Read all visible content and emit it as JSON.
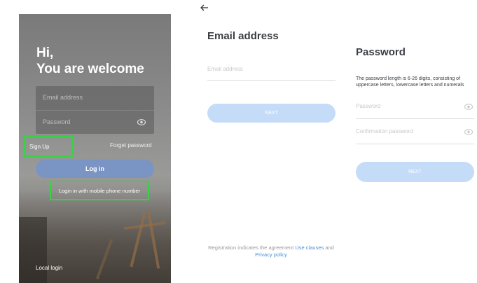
{
  "login": {
    "greeting_line1": "Hi,",
    "greeting_line2": "You are welcome",
    "email_placeholder": "Email address",
    "password_placeholder": "Password",
    "sign_up": "Sign Up",
    "forget_password": "Forget password",
    "login_button": "Log in",
    "mobile_login": "Login in with mobile phone number",
    "local_login": "Local login"
  },
  "email_screen": {
    "title": "Email address",
    "email_placeholder": "Email address",
    "next_button": "NEXT",
    "agreement_prefix": "Registration indicates the agreement ",
    "use_clauses": "Use clauses",
    "and": " and",
    "privacy_policy": "Privacy policy"
  },
  "password_screen": {
    "title": "Password",
    "description": "The password length is 6-26 digits, consisting of uppercase letters, lowercase letters and numerals",
    "password_placeholder": "Password",
    "confirm_placeholder": "Confirmation password",
    "next_button": "NEXT"
  },
  "colors": {
    "highlight": "#39d04a",
    "login_button": "#7a95c4",
    "next_button": "#c5dcf9",
    "link": "#4a8dd9"
  },
  "icons": {
    "back": "back-arrow-icon",
    "eye": "eye-icon"
  }
}
